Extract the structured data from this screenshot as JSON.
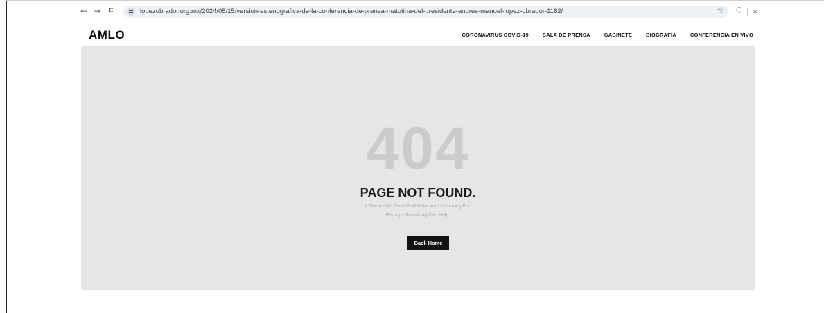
{
  "browser": {
    "url": "lopezobrador.org.mx/2024/05/15/version-estenografica-de-la-conferencia-de-prensa-matutina-del-presidente-andres-manuel-lopez-obrador-1182/",
    "back_icon": "←",
    "forward_icon": "→",
    "reload_icon": "C",
    "star_icon": "☆",
    "extension_icon": "⬡",
    "download_icon": "⤓"
  },
  "header": {
    "logo": "AMLO",
    "nav": [
      "CORONAVIRUS COVID-19",
      "SALA DE PRENSA",
      "GABINETE",
      "BIOGRAFÍA",
      "CONFERENCIA EN VIVO"
    ]
  },
  "main": {
    "code": "404",
    "title": "PAGE NOT FOUND.",
    "message_line1": "It Seems We Can't Find What You're Looking For.",
    "message_line2": "Perhaps Searching Can Help.",
    "button": "Back Home"
  },
  "colors": {
    "hero_bg": "#e6e6e6",
    "code_color": "#cbcbcb",
    "button_bg": "#121212"
  }
}
